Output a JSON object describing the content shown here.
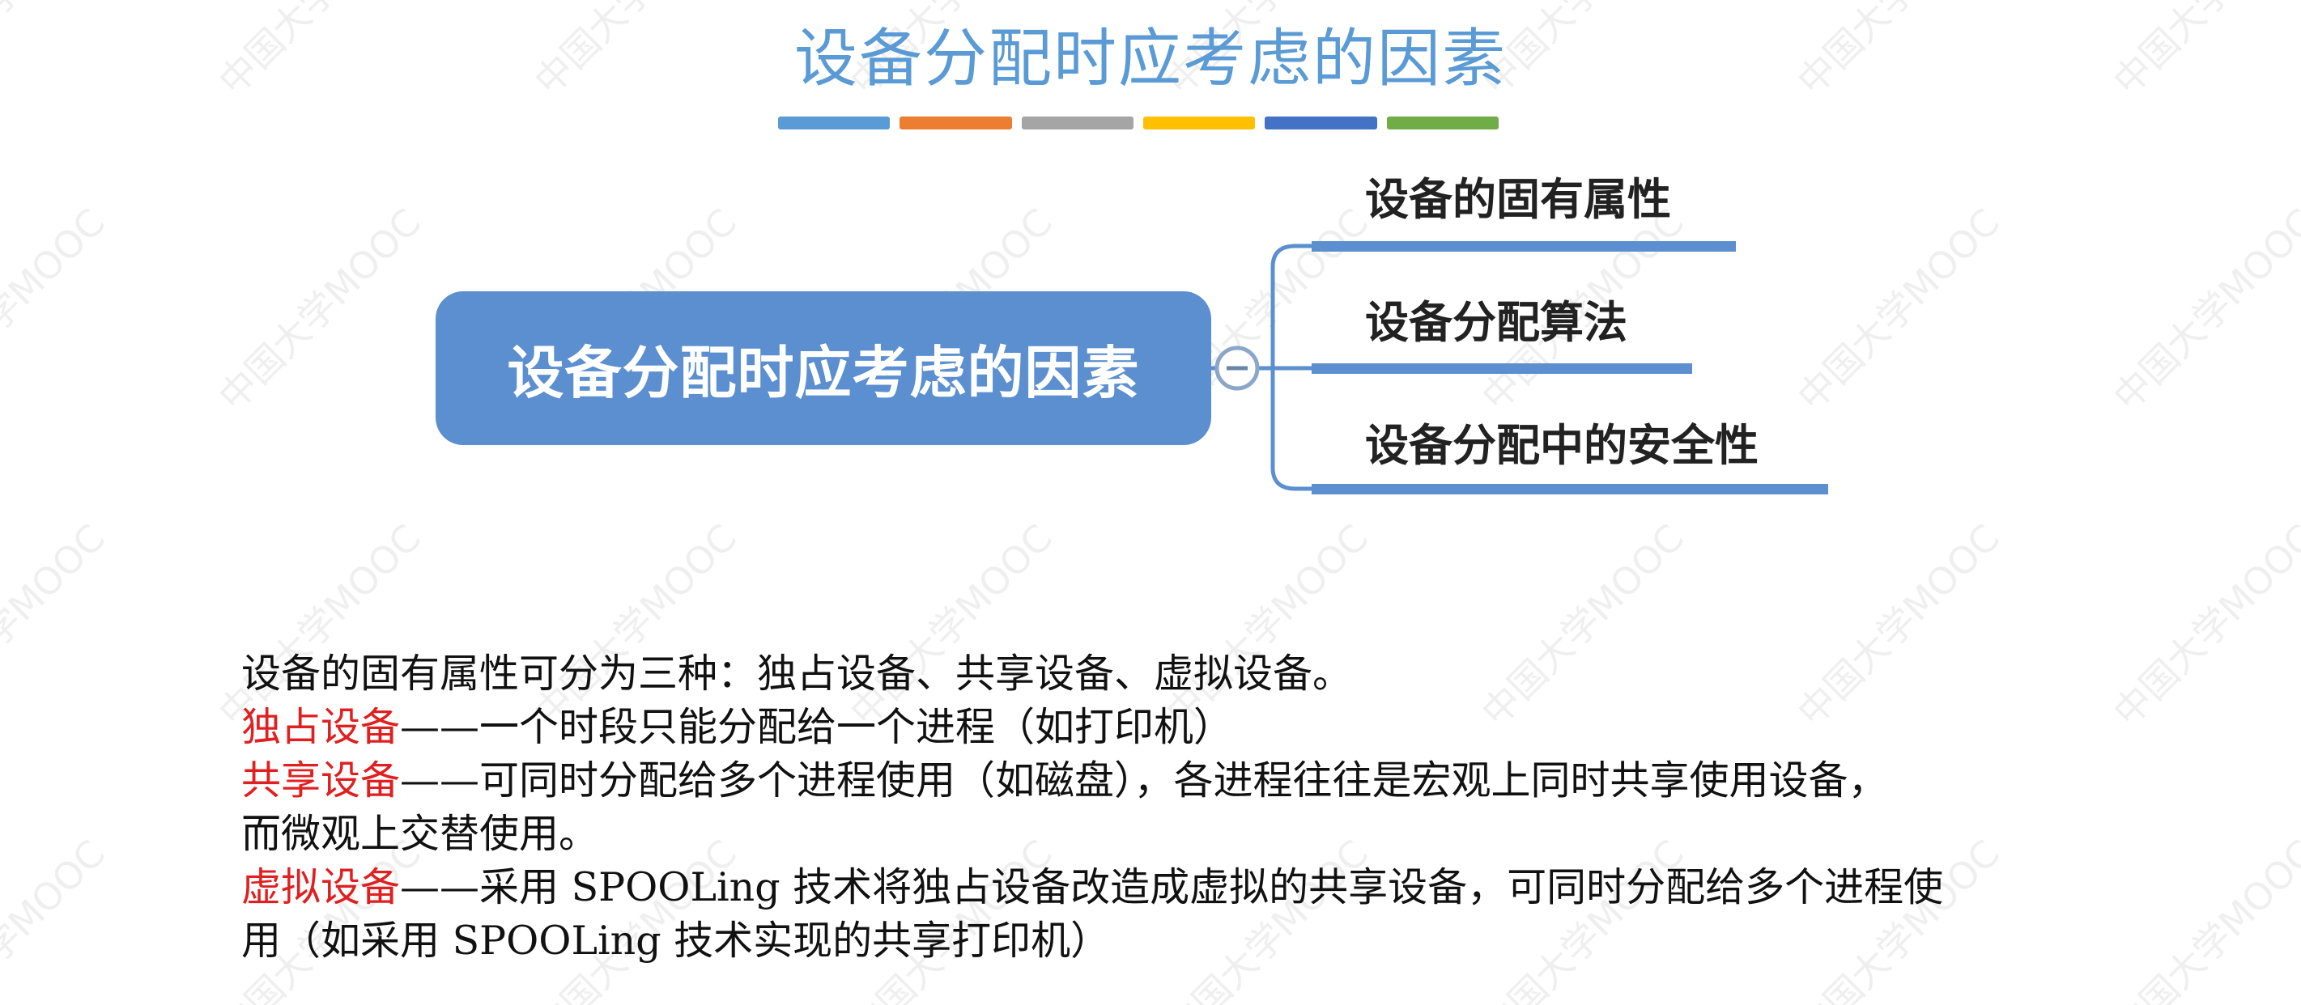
{
  "title": "设备分配时应考虑的因素",
  "title_bar_colors": [
    "#5b9bd5",
    "#ed7d31",
    "#a5a5a5",
    "#ffc000",
    "#4472c4",
    "#70ad47"
  ],
  "mindmap": {
    "root": "设备分配时应考虑的因素",
    "collapse_symbol": "−",
    "branches": [
      {
        "label": "设备的固有属性"
      },
      {
        "label": "设备分配算法"
      },
      {
        "label": "设备分配中的安全性"
      }
    ]
  },
  "body": {
    "intro": "设备的固有属性可分为三种：独占设备、共享设备、虚拟设备。",
    "exclusive_term": "独占设备",
    "exclusive_desc": "——一个时段只能分配给一个进程（如打印机）",
    "shared_term": "共享设备",
    "shared_desc_1": "——可同时分配给多个进程使用（如磁盘），各进程往往是宏观上同时共享使用设备，",
    "shared_desc_2": "而微观上交替使用。",
    "virtual_term": "虚拟设备",
    "virtual_desc_1": "——采用 SPOOLing 技术将独占设备改造成虚拟的共享设备，可同时分配给多个进程使",
    "virtual_desc_2": "用（如采用 SPOOLing 技术实现的共享打印机）"
  },
  "watermark_text": "中国大学MOOC",
  "colors": {
    "accent": "#5b8fd0",
    "term_red": "#e02020"
  }
}
